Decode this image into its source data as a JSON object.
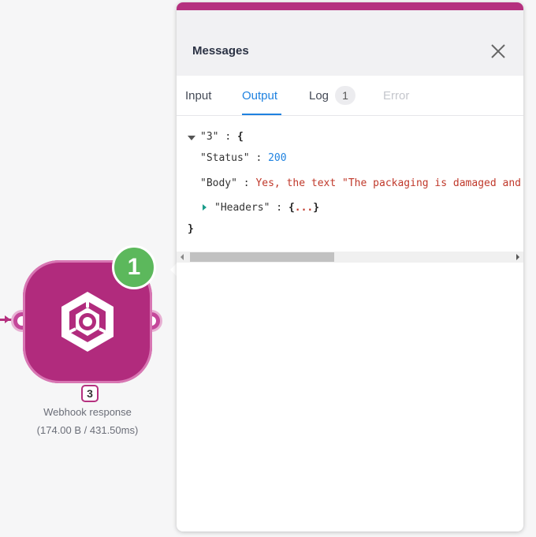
{
  "module": {
    "badge_count": "1",
    "module_id": "3",
    "name": "Webhook response",
    "stats": "(174.00 B / 431.50ms)",
    "icon": "webhook-hexagon-icon",
    "color": "#b12b7d"
  },
  "panel": {
    "title": "Messages",
    "close_icon": "close-icon",
    "accent": "#b5307f",
    "tabs": {
      "input": "Input",
      "output": "Output",
      "log": "Log",
      "log_count": "1",
      "error": "Error"
    },
    "output": {
      "root_key": "\"3\"",
      "status_key": "\"Status\"",
      "status_value": "200",
      "body_key": "\"Body\"",
      "body_value": "Yes, the text \"The packaging is damaged and",
      "headers_key": "\"Headers\"",
      "headers_collapsed": "...",
      "open_brace": "{",
      "close_brace": "}",
      "colon": ":"
    }
  }
}
